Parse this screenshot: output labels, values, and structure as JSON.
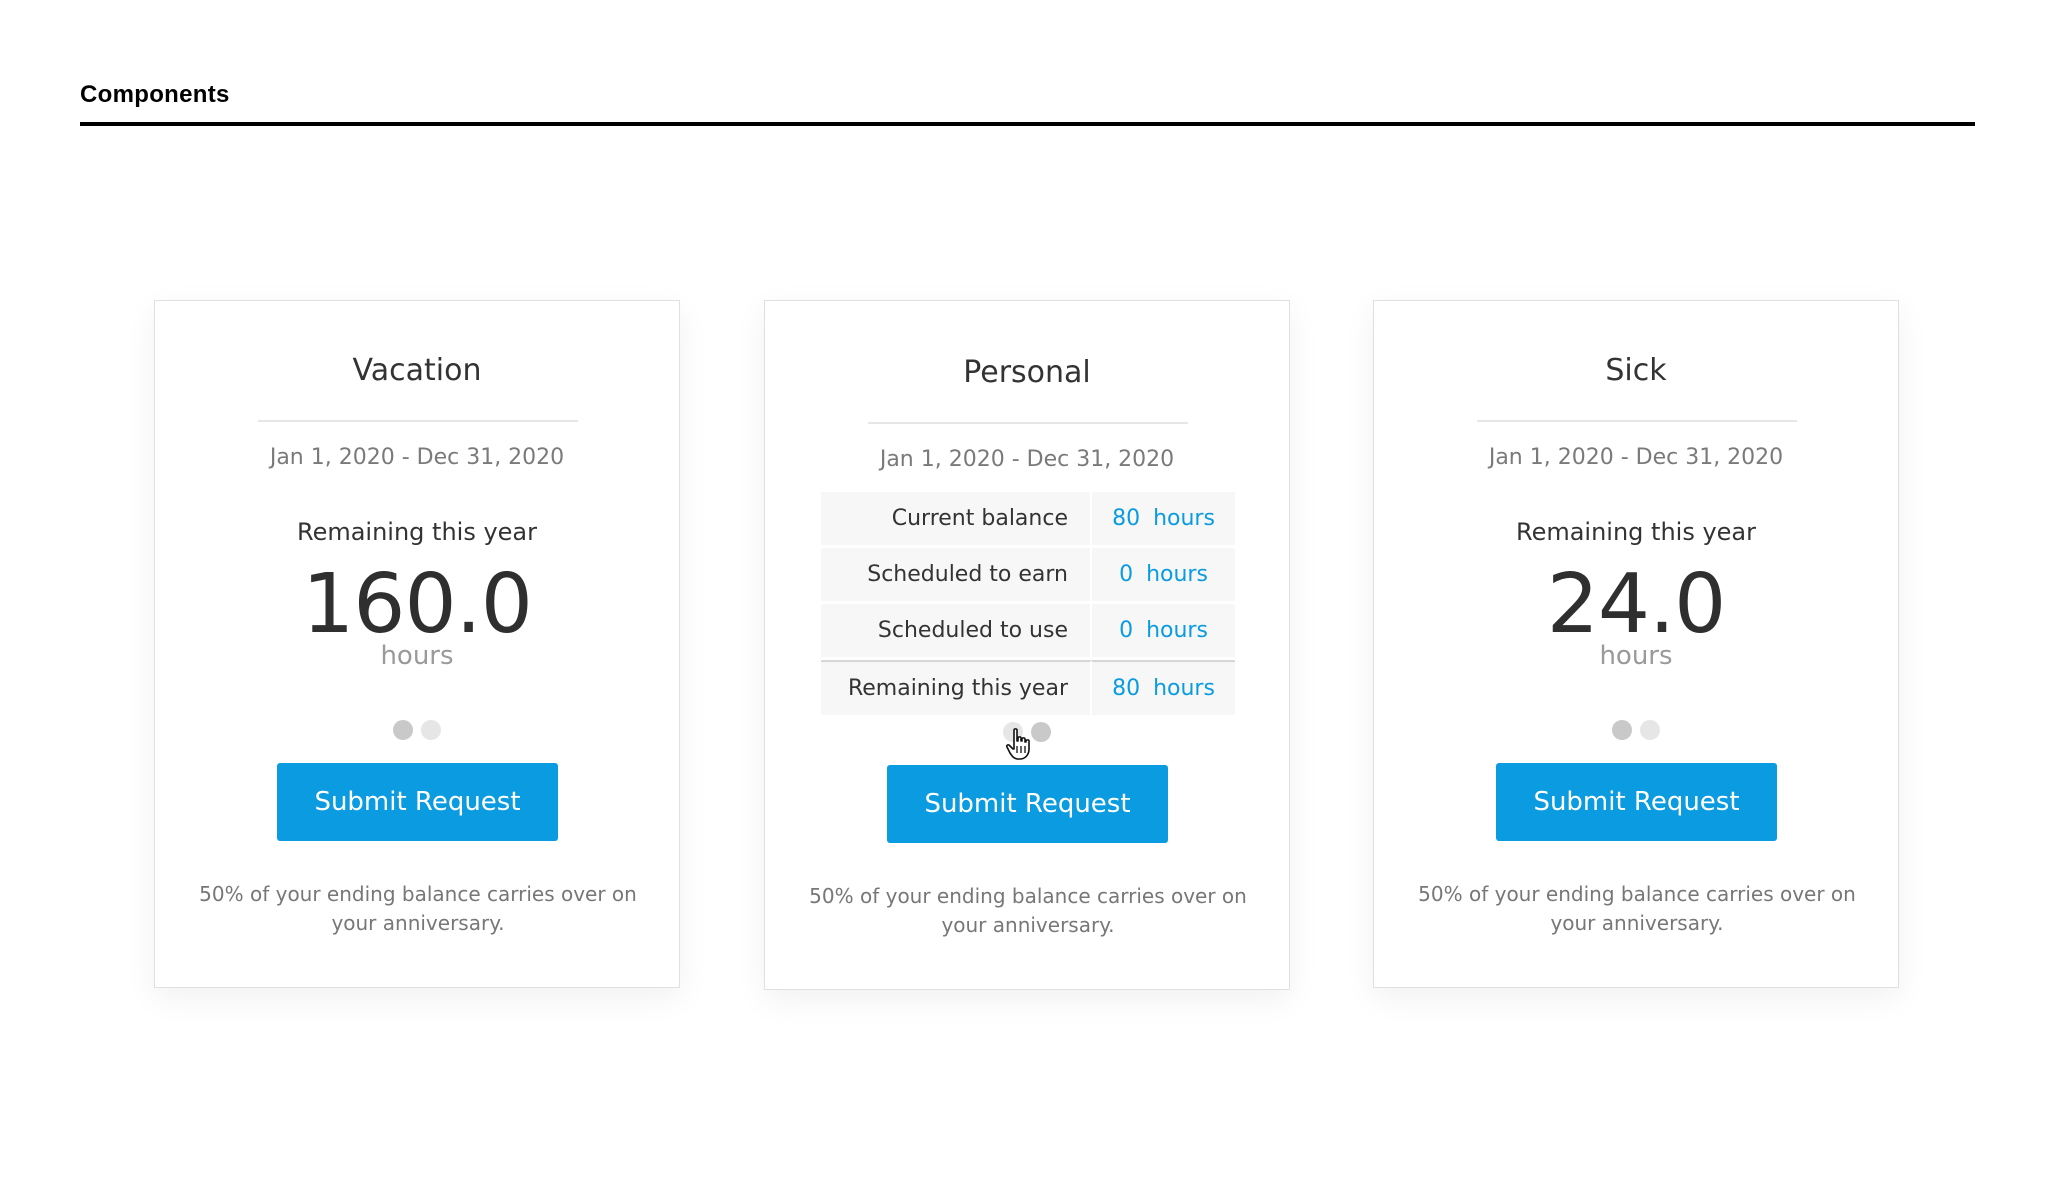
{
  "page": {
    "section_title": "Components"
  },
  "cards": [
    {
      "title": "Vacation",
      "dates": "Jan 1, 2020 - Dec 31, 2020",
      "remaining_label": "Remaining this year",
      "value": "160.0",
      "unit": "hours",
      "button": "Submit Request",
      "footnote": "50% of your ending balance carries over on your anniversary.",
      "active_dot": 1
    },
    {
      "title": "Personal",
      "dates": "Jan 1, 2020 - Dec 31, 2020",
      "rows": [
        {
          "label": "Current balance",
          "value": "80 hours"
        },
        {
          "label": "Scheduled to earn",
          "value": "0 hours"
        },
        {
          "label": "Scheduled to use",
          "value": "0 hours"
        },
        {
          "label": "Remaining this year",
          "value": "80 hours"
        }
      ],
      "button": "Submit Request",
      "footnote": "50% of your ending balance carries over on your anniversary.",
      "active_dot": 2
    },
    {
      "title": "Sick",
      "dates": "Jan 1, 2020 - Dec 31, 2020",
      "remaining_label": "Remaining this year",
      "value": "24.0",
      "unit": "hours",
      "button": "Submit Request",
      "footnote": "50% of your ending balance carries over on your anniversary.",
      "active_dot": 1
    }
  ],
  "colors": {
    "accent": "#0a9be0",
    "dot_active": "#c9c9c9",
    "dot_inactive": "#e6e6e6"
  },
  "icons": {
    "cursor": "hand-pointer-icon"
  }
}
